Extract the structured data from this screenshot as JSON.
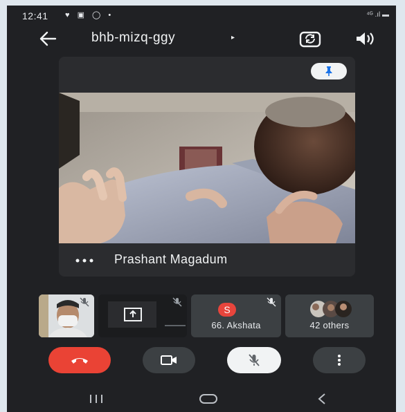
{
  "status": {
    "time": "12:41",
    "left_icons": "♥ ▣ ◯ •",
    "right_icons": "⁴ᴳ .ıl ▬"
  },
  "meeting": {
    "code": "bhb-mizq-ggy",
    "caret": "▸"
  },
  "main_tile": {
    "participant_name": "Prashant Magadum"
  },
  "thumbnails": [
    {
      "name": "self-video",
      "muted": true
    },
    {
      "name": "screen-share",
      "muted": true
    },
    {
      "initial": "S",
      "label": "66. Akshata",
      "avatar_color": "#e8453c",
      "muted": true
    },
    {
      "label": "42 others"
    }
  ],
  "controls": [
    {
      "name": "end-call",
      "color": "#ea4335"
    },
    {
      "name": "camera",
      "color": "#3c4043"
    },
    {
      "name": "microphone-muted",
      "color": "#f1f3f4"
    },
    {
      "name": "more-options",
      "color": "#3c4043"
    }
  ],
  "icons": {
    "back": "arrow-left-icon",
    "switch_camera": "switch-camera-icon",
    "audio": "speaker-icon",
    "pin": "pin-icon",
    "nav_recents": "recents-icon",
    "nav_home": "home-icon",
    "nav_back": "nav-back-icon"
  }
}
